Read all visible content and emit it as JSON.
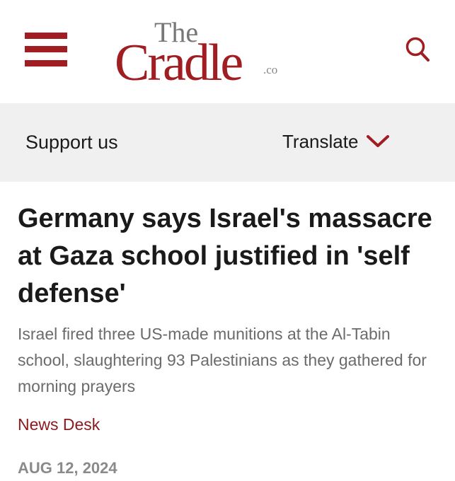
{
  "header": {
    "logo": {
      "the": "The",
      "cradle": "Cradle",
      "tld": ".co"
    },
    "menu_icon": "hamburger-menu-icon",
    "search_icon": "search-icon"
  },
  "subbar": {
    "support_label": "Support us",
    "translate_label": "Translate",
    "translate_icon": "chevron-down-icon"
  },
  "article": {
    "headline": "Germany says Israel's massacre at Gaza school justified in 'self defense'",
    "subheadline": "Israel fired three US-made munitions at the Al-Tabin school, slaughtering 93 Palestinians as they gathered for morning prayers",
    "author": "News Desk",
    "date": "AUG 12, 2024"
  },
  "colors": {
    "brand_red": "#a01e22",
    "author_red": "#8a1a1d",
    "subbar_bg": "#f0f0f0",
    "text_dark": "#1a1a1a",
    "text_gray": "#6b6b6b",
    "date_gray": "#8a8a8a"
  }
}
